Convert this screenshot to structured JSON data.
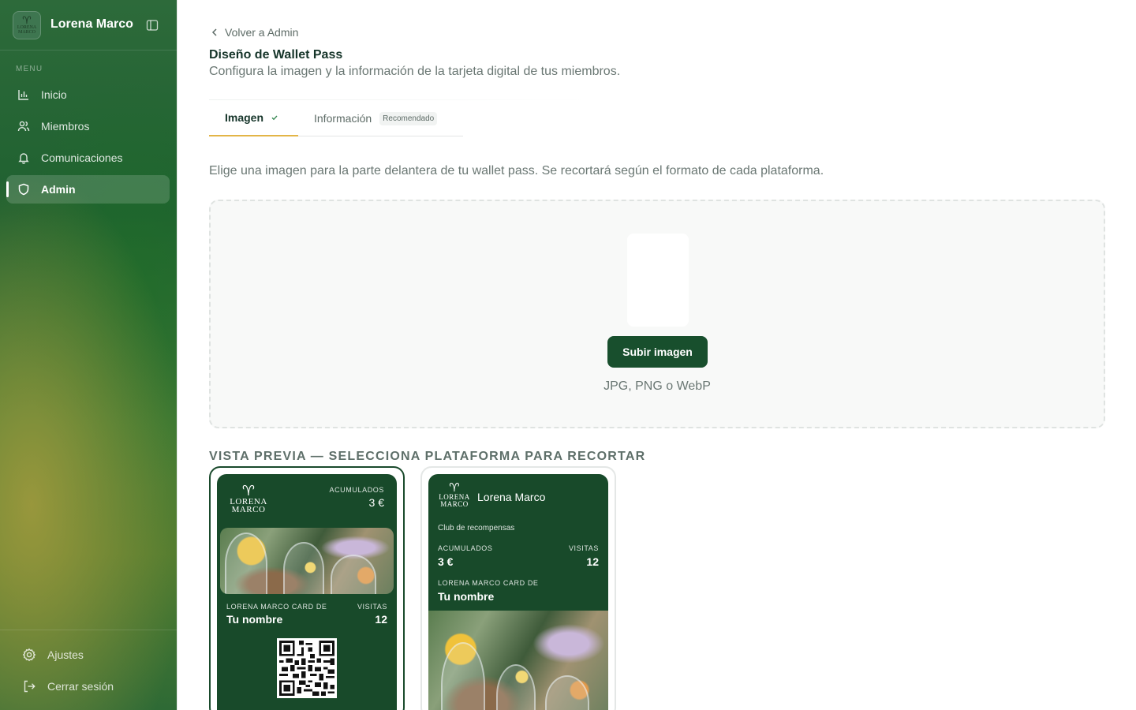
{
  "sidebar": {
    "brand_name": "Lorena Marco",
    "logo_text": "LORENA MARCO",
    "menu_label": "MENU",
    "items": [
      {
        "label": "Inicio",
        "icon": "bar-chart-icon"
      },
      {
        "label": "Miembros",
        "icon": "users-icon"
      },
      {
        "label": "Comunicaciones",
        "icon": "bell-icon"
      },
      {
        "label": "Admin",
        "icon": "shield-icon",
        "active": true
      }
    ],
    "footer": {
      "settings_label": "Ajustes",
      "logout_label": "Cerrar sesión"
    }
  },
  "header": {
    "back_label": "Volver a Admin",
    "title": "Diseño de Wallet Pass",
    "subtitle": "Configura la imagen y la información de la tarjeta digital de tus miembros."
  },
  "tabs": [
    {
      "label": "Imagen",
      "active": true,
      "completed": true
    },
    {
      "label": "Información",
      "badge": "Recomendado"
    }
  ],
  "image_step": {
    "instructions": "Elige una imagen para la parte delantera de tu wallet pass. Se recortará según el formato de cada plataforma.",
    "upload_button": "Subir imagen",
    "formats": "JPG, PNG o WebP"
  },
  "preview": {
    "label": "VISTA PREVIA — SELECCIONA PLATAFORMA PARA RECORTAR",
    "card_a": {
      "selected": true,
      "accumulated_label": "ACUMULADOS",
      "accumulated_value": "3 €",
      "holder_label": "LORENA MARCO CARD DE",
      "holder_value": "Tu nombre",
      "visits_label": "VISITAS",
      "visits_value": "12"
    },
    "card_b": {
      "selected": false,
      "brand_name": "Lorena Marco",
      "program": "Club de recompensas",
      "accumulated_label": "ACUMULADOS",
      "accumulated_value": "3 €",
      "visits_label": "VISITAS",
      "visits_value": "12",
      "holder_label": "LORENA MARCO CARD DE",
      "holder_value": "Tu nombre"
    }
  },
  "colors": {
    "brand_green": "#184a2a",
    "accent_gold": "#e3b547",
    "primary_button": "#184f2d"
  }
}
